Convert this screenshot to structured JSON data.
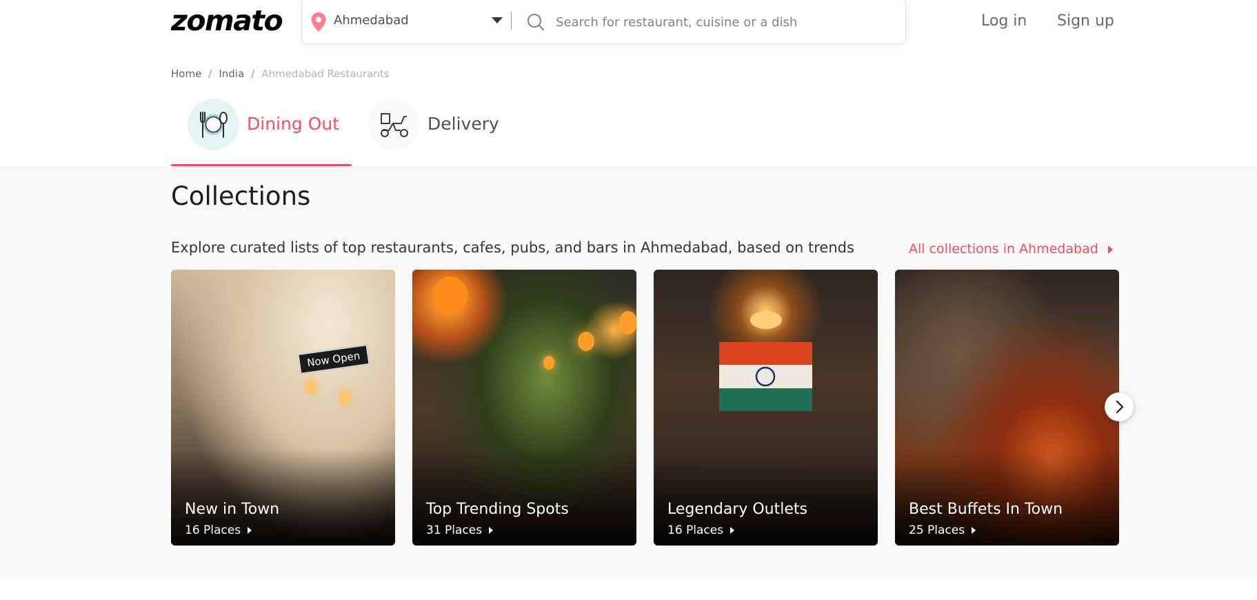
{
  "header": {
    "logo_text": "zomato",
    "location": "Ahmedabad",
    "search_placeholder": "Search for restaurant, cuisine or a dish",
    "login_label": "Log in",
    "signup_label": "Sign up"
  },
  "breadcrumb": {
    "items": [
      "Home",
      "India",
      "Ahmedabad Restaurants"
    ],
    "separator": "/"
  },
  "tabs": [
    {
      "label": "Dining Out",
      "active": true,
      "icon": "dining-icon"
    },
    {
      "label": "Delivery",
      "active": false,
      "icon": "delivery-scooter-icon"
    }
  ],
  "collections": {
    "title": "Collections",
    "description": "Explore curated lists of top restaurants, cafes, pubs, and bars in Ahmedabad, based on trends",
    "all_link": "All collections in Ahmedabad",
    "cards": [
      {
        "title": "New in Town",
        "count": "16 Places",
        "sign_text": "Now Open"
      },
      {
        "title": "Top Trending Spots",
        "count": "31 Places"
      },
      {
        "title": "Legendary Outlets",
        "count": "16 Places"
      },
      {
        "title": "Best Buffets In Town",
        "count": "25 Places"
      }
    ]
  },
  "colors": {
    "accent": "#ef4f5f",
    "text_dark": "#1c1c1c",
    "section_bg": "#f8f8f8"
  }
}
